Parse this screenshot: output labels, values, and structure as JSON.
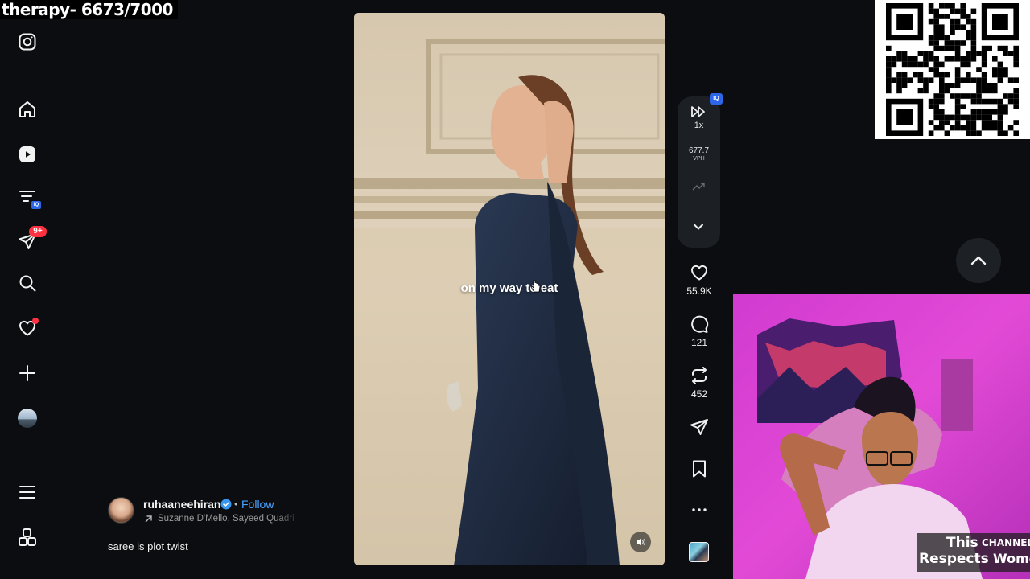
{
  "overlay": {
    "title": "therapy- 6673/7000"
  },
  "sidebar": {
    "icons": [
      "instagram-icon",
      "home-icon",
      "reels-icon",
      "feed-filter-icon",
      "messages-icon",
      "search-icon",
      "notifications-icon",
      "create-icon",
      "profile-avatar",
      "menu-icon",
      "more-icon"
    ],
    "filter_badge": "IQ",
    "messages_badge": "9+"
  },
  "video": {
    "caption": "on my way to eat"
  },
  "speed_panel": {
    "speed": "1x",
    "vph_value": "677.7",
    "vph_label": "VPH",
    "trend_dots": "...",
    "iq_badge": "IQ"
  },
  "actions": {
    "likes": "55.9K",
    "comments": "121",
    "reposts": "452"
  },
  "post": {
    "username": "ruhaaneehiran",
    "separator": "•",
    "follow_label": "Follow",
    "collaborators": "Suzanne D'Mello, Sayeed Quadri",
    "caption": "saree is plot twist"
  },
  "channel_tag": {
    "this": "This",
    "channel": "CHANNEL",
    "respects": "Respects",
    "women": "Women"
  },
  "colors": {
    "accent_blue": "#4aa3ff",
    "badge_red": "#ff3040",
    "iq_blue": "#2d66e8",
    "background": "#0b0d10"
  }
}
